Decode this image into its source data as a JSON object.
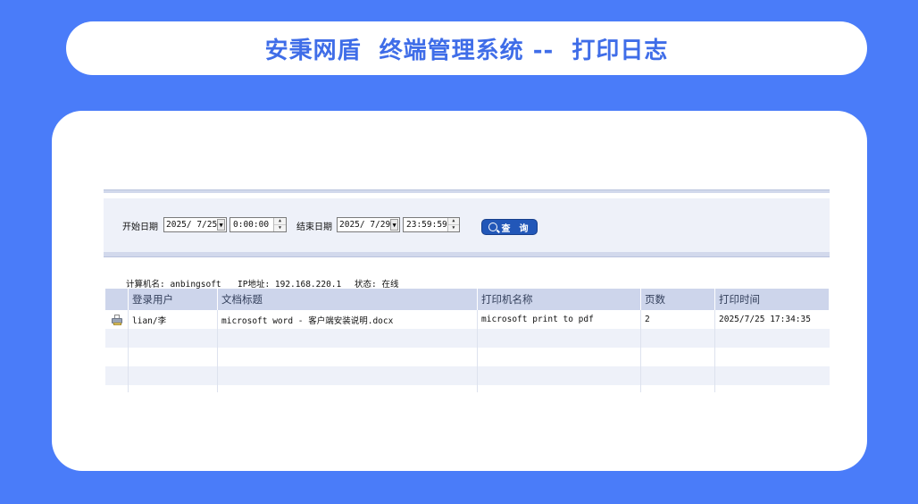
{
  "banner": {
    "title": "安秉网盾  终端管理系统 --  打印日志"
  },
  "filter": {
    "start_label": "开始日期",
    "start_date": "2025/ 7/25",
    "start_time": "0:00:00",
    "end_label": "结束日期",
    "end_date": "2025/ 7/29",
    "end_time": "23:59:59",
    "query_label": "查 询"
  },
  "info": {
    "computer": "计算机名: anbingsoft",
    "ip": "IP地址: 192.168.220.1",
    "status": "状态: 在线"
  },
  "table": {
    "columns": [
      "登录用户",
      "文档标题",
      "打印机名称",
      "页数",
      "打印时间"
    ],
    "rows": [
      {
        "user": "lian/李",
        "title": "microsoft word - 客户端安装说明.docx",
        "printer": "microsoft print to pdf",
        "pages": "2",
        "time": "2025/7/25 17:34:35"
      }
    ]
  },
  "colors": {
    "background": "#4a7cf9",
    "title": "#3f6de8",
    "query_button": "#2257b8",
    "header_row": "#cdd5eb"
  }
}
